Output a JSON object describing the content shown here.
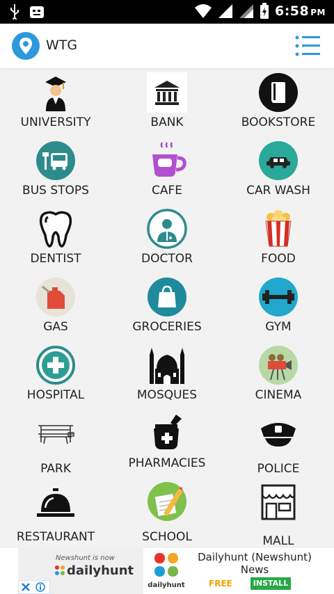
{
  "status_bar": {
    "time": "6:58",
    "ampm": "PM"
  },
  "app_bar": {
    "title": "WTG"
  },
  "categories": [
    {
      "label": "UNIVERSITY"
    },
    {
      "label": "BANK"
    },
    {
      "label": "BOOKSTORE"
    },
    {
      "label": "BUS STOPS"
    },
    {
      "label": "CAFE"
    },
    {
      "label": "CAR WASH"
    },
    {
      "label": "DENTIST"
    },
    {
      "label": "DOCTOR"
    },
    {
      "label": "FOOD"
    },
    {
      "label": "GAS"
    },
    {
      "label": "GROCERIES"
    },
    {
      "label": "GYM"
    },
    {
      "label": "HOSPITAL"
    },
    {
      "label": "MOSQUES"
    },
    {
      "label": "CINEMA"
    },
    {
      "label": "PARK"
    },
    {
      "label": "PHARMACIES"
    },
    {
      "label": "POLICE"
    },
    {
      "label": "RESTAURANT"
    },
    {
      "label": "SCHOOL"
    },
    {
      "label": "MALL"
    }
  ],
  "ad": {
    "brand_small": "Newshunt is now",
    "brand_big": "dailyhunt",
    "icon_label": "dailyhunt",
    "title": "Dailyhunt (Newshunt) News",
    "free": "FREE",
    "install": "INSTALL"
  },
  "colors": {
    "accent": "#2d98da",
    "teal": "#2e8b8b",
    "install": "#28a745"
  }
}
